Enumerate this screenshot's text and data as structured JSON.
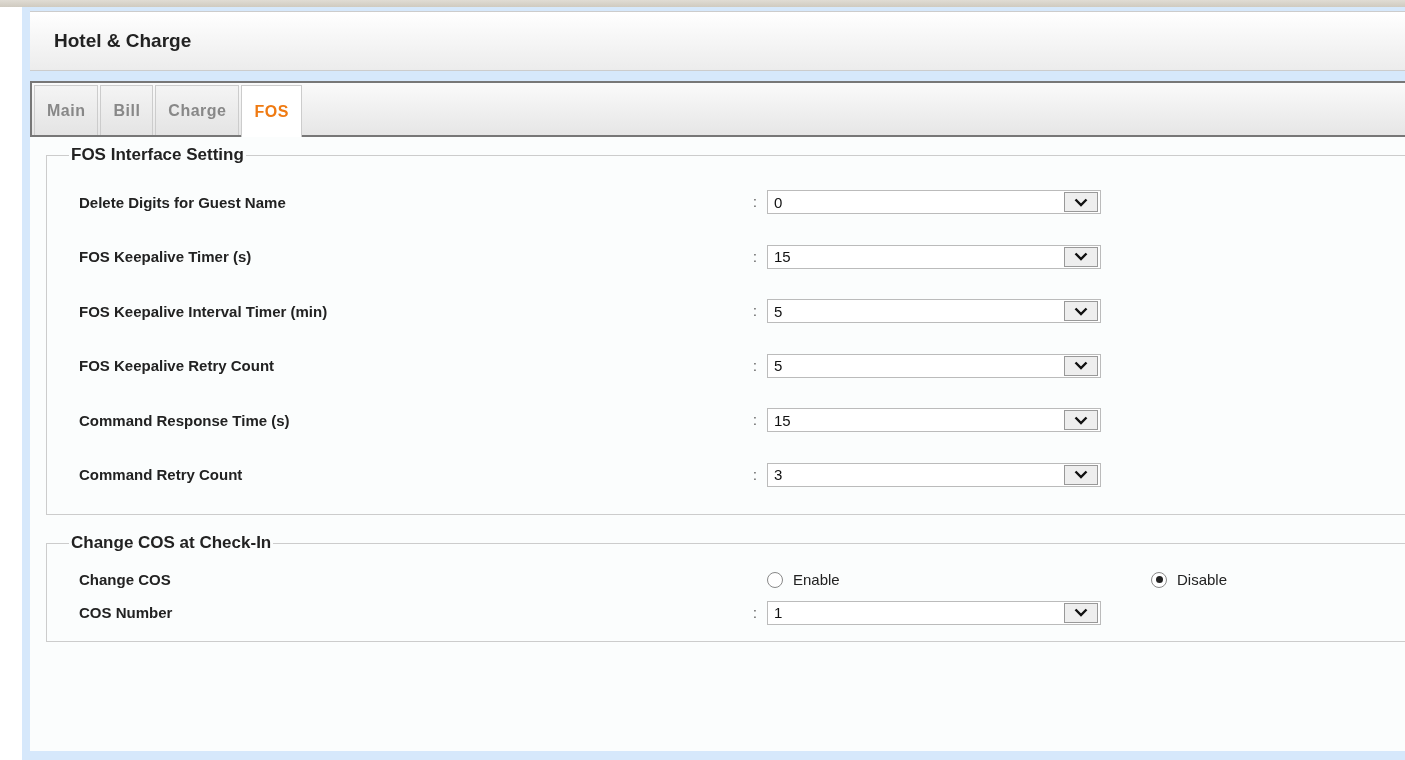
{
  "header": {
    "title": "Hotel & Charge"
  },
  "tabs": [
    {
      "label": "Main",
      "selected": false
    },
    {
      "label": "Bill",
      "selected": false
    },
    {
      "label": "Charge",
      "selected": false
    },
    {
      "label": "FOS",
      "selected": true
    }
  ],
  "sections": [
    {
      "title": "FOS Interface Setting",
      "rows": [
        {
          "kind": "select",
          "label": "Delete Digits for Guest Name",
          "separator": ":",
          "value": "0"
        },
        {
          "kind": "select",
          "label": "FOS Keepalive Timer (s)",
          "separator": ":",
          "value": "15"
        },
        {
          "kind": "select",
          "label": "FOS Keepalive Interval Timer (min)",
          "separator": ":",
          "value": "5"
        },
        {
          "kind": "select",
          "label": "FOS Keepalive Retry Count",
          "separator": ":",
          "value": "5"
        },
        {
          "kind": "select",
          "label": "Command Response Time (s)",
          "separator": ":",
          "value": "15"
        },
        {
          "kind": "select",
          "label": "Command Retry Count",
          "separator": ":",
          "value": "3"
        }
      ]
    },
    {
      "title": "Change COS at Check-In",
      "rows": [
        {
          "kind": "radio",
          "label": "Change COS",
          "options": [
            {
              "label": "Enable",
              "selected": false
            },
            {
              "label": "Disable",
              "selected": true
            }
          ]
        },
        {
          "kind": "select",
          "label": "COS Number",
          "separator": ":",
          "value": "1"
        }
      ]
    }
  ]
}
